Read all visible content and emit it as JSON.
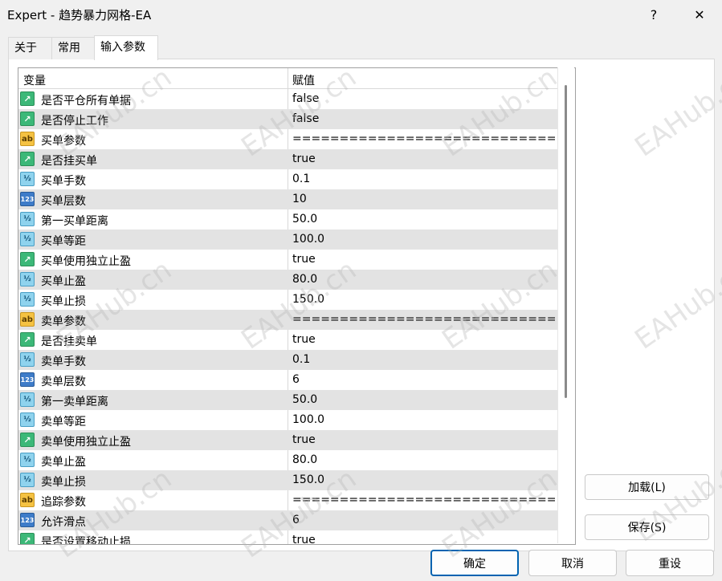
{
  "window": {
    "title": "Expert - 趋势暴力网格-EA",
    "help": "?",
    "close": "✕"
  },
  "tabs": [
    {
      "label": "关于"
    },
    {
      "label": "常用"
    },
    {
      "label": "输入参数"
    }
  ],
  "grid": {
    "col_variable": "变量",
    "col_value": "赋值",
    "rows": [
      {
        "type": "bool",
        "name": "是否平仓所有单据",
        "value": "false"
      },
      {
        "type": "bool",
        "name": "是否停止工作",
        "value": "false"
      },
      {
        "type": "str",
        "name": "买单参数",
        "value": "============================..."
      },
      {
        "type": "bool",
        "name": "是否挂买单",
        "value": "true"
      },
      {
        "type": "dbl",
        "name": "买单手数",
        "value": "0.1"
      },
      {
        "type": "int",
        "name": "买单层数",
        "value": "10"
      },
      {
        "type": "dbl",
        "name": "第一买单距离",
        "value": "50.0"
      },
      {
        "type": "dbl",
        "name": "买单等距",
        "value": "100.0"
      },
      {
        "type": "bool",
        "name": "买单使用独立止盈",
        "value": "true"
      },
      {
        "type": "dbl",
        "name": "买单止盈",
        "value": "80.0"
      },
      {
        "type": "dbl",
        "name": "买单止损",
        "value": "150.0"
      },
      {
        "type": "str",
        "name": "卖单参数",
        "value": "============================..."
      },
      {
        "type": "bool",
        "name": "是否挂卖单",
        "value": "true"
      },
      {
        "type": "dbl",
        "name": "卖单手数",
        "value": "0.1"
      },
      {
        "type": "int",
        "name": "卖单层数",
        "value": "6"
      },
      {
        "type": "dbl",
        "name": "第一卖单距离",
        "value": "50.0"
      },
      {
        "type": "dbl",
        "name": "卖单等距",
        "value": "100.0"
      },
      {
        "type": "bool",
        "name": "卖单使用独立止盈",
        "value": "true"
      },
      {
        "type": "dbl",
        "name": "卖单止盈",
        "value": "80.0"
      },
      {
        "type": "dbl",
        "name": "卖单止损",
        "value": "150.0"
      },
      {
        "type": "str",
        "name": "追踪参数",
        "value": "============================..."
      },
      {
        "type": "int",
        "name": "允许滑点",
        "value": "6"
      },
      {
        "type": "bool",
        "name": "是否设置移动止损",
        "value": "true"
      }
    ]
  },
  "icons": {
    "bool": {
      "glyph": "↗",
      "name": "bool-icon"
    },
    "str": {
      "glyph": "ab",
      "name": "string-icon"
    },
    "dbl": {
      "glyph": "½",
      "name": "double-icon"
    },
    "int": {
      "glyph": "123",
      "name": "integer-icon"
    }
  },
  "side_buttons": {
    "load": "加载(L)",
    "save": "保存(S)"
  },
  "footer": {
    "ok": "确定",
    "cancel": "取消",
    "reset": "重设"
  },
  "watermark": "EAHub.cn"
}
